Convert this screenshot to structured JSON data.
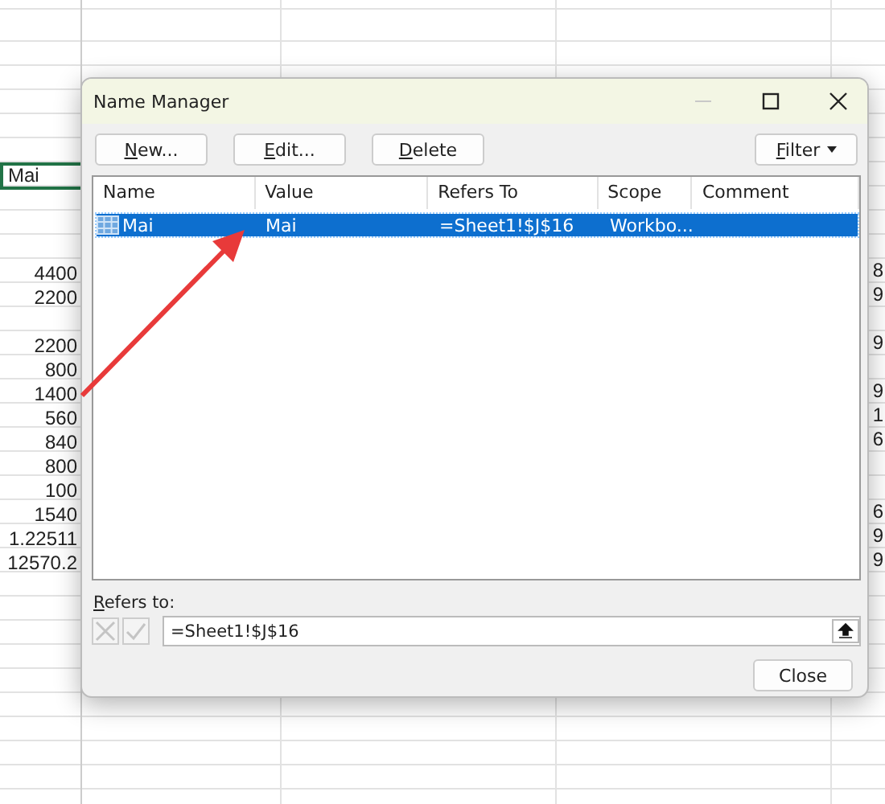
{
  "spreadsheet": {
    "name_cell": "Mai",
    "column_a": [
      {
        "kind": "blank"
      },
      {
        "kind": "blank"
      },
      {
        "kind": "blank"
      },
      {
        "kind": "value",
        "text": "4400"
      },
      {
        "kind": "value",
        "text": "2200"
      },
      {
        "kind": "blank"
      },
      {
        "kind": "value",
        "text": "2200"
      },
      {
        "kind": "value",
        "text": "800"
      },
      {
        "kind": "value",
        "text": "1400"
      },
      {
        "kind": "value",
        "text": "560"
      },
      {
        "kind": "value",
        "text": "840"
      },
      {
        "kind": "value",
        "text": "800"
      },
      {
        "kind": "value",
        "text": "100"
      },
      {
        "kind": "value",
        "text": "1540"
      },
      {
        "kind": "value",
        "text": "1.22511"
      },
      {
        "kind": "value",
        "text": "12570.2"
      }
    ],
    "column_right": [
      {
        "kind": "blank"
      },
      {
        "kind": "blank"
      },
      {
        "kind": "blank"
      },
      {
        "kind": "value",
        "text": "8"
      },
      {
        "kind": "value",
        "text": "9"
      },
      {
        "kind": "blank"
      },
      {
        "kind": "value",
        "text": "9"
      },
      {
        "kind": "blank"
      },
      {
        "kind": "value",
        "text": "9"
      },
      {
        "kind": "value",
        "text": "1"
      },
      {
        "kind": "value",
        "text": "6"
      },
      {
        "kind": "blank"
      },
      {
        "kind": "blank"
      },
      {
        "kind": "value",
        "text": "6"
      },
      {
        "kind": "value",
        "text": "9"
      },
      {
        "kind": "value",
        "text": "9"
      }
    ]
  },
  "dialog": {
    "title": "Name Manager",
    "window_controls": [
      {
        "kind": "minimize",
        "disabled": true
      },
      {
        "kind": "maximize",
        "disabled": false
      },
      {
        "kind": "close",
        "disabled": false
      }
    ],
    "buttons": [
      {
        "label": "New...",
        "underline_first": true
      },
      {
        "label": "Edit...",
        "underline_first": true
      },
      {
        "label": "Delete",
        "underline_first": true
      }
    ],
    "filter": {
      "label": "Filter",
      "underline_first": true
    },
    "table": {
      "columns": [
        "Name",
        "Value",
        "Refers To",
        "Scope",
        "Comment"
      ],
      "rows": [
        {
          "name": "Mai",
          "value": "Mai",
          "refers_to": "=Sheet1!$J$16",
          "scope": "Workbo...",
          "selected": true
        }
      ]
    },
    "refers_to": {
      "label": "Refers to:",
      "underline_first": true,
      "value": "=Sheet1!$J$16",
      "cancel_disabled": true,
      "confirm_disabled": true
    },
    "close_button": "Close"
  },
  "annotation": {
    "kind": "arrow"
  }
}
